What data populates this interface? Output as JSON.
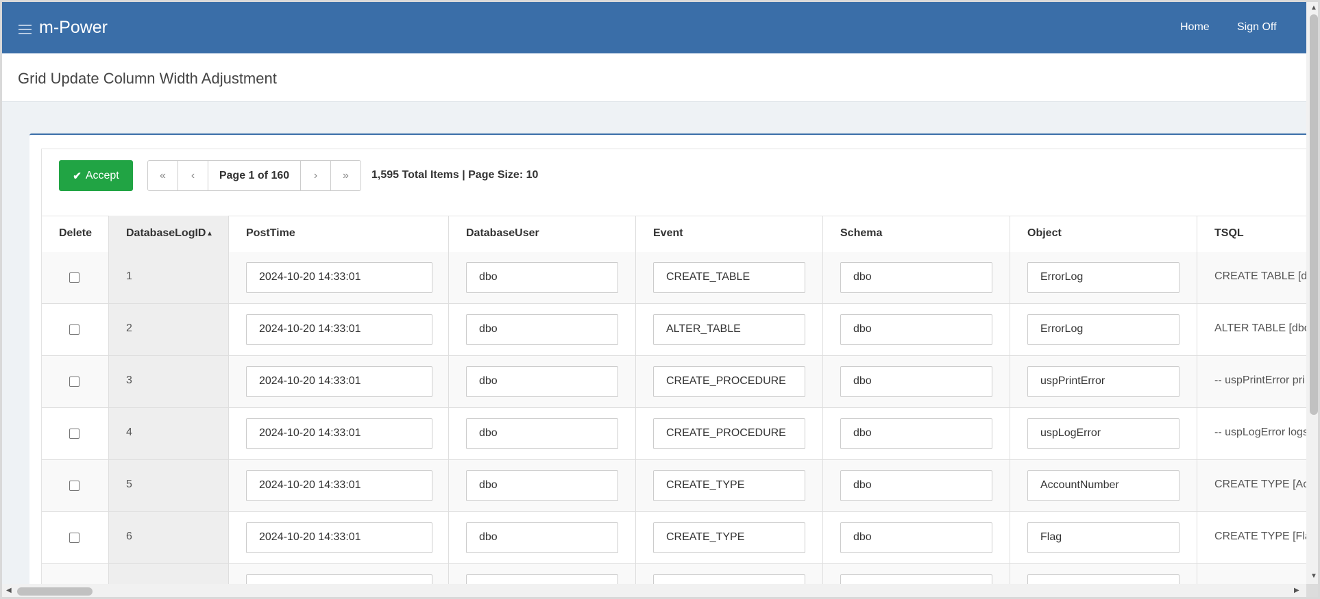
{
  "header": {
    "brand": "m-Power",
    "nav": [
      {
        "label": "Home"
      },
      {
        "label": "Sign Off"
      }
    ]
  },
  "page": {
    "title": "Grid Update Column Width Adjustment"
  },
  "toolbar": {
    "accept_label": "Accept",
    "accept_icon": "check-icon",
    "pager": {
      "first_icon": "«",
      "prev_icon": "‹",
      "page_info": "Page 1 of 160",
      "next_icon": "›",
      "last_icon": "»"
    },
    "totals": "1,595 Total Items | Page Size: 10"
  },
  "grid": {
    "columns": [
      "Delete",
      "DatabaseLogID",
      "PostTime",
      "DatabaseUser",
      "Event",
      "Schema",
      "Object",
      "TSQL"
    ],
    "sort_indicator": "▲",
    "rows": [
      {
        "id": "1",
        "posttime": "2024-10-20 14:33:01",
        "user": "dbo",
        "event": "CREATE_TABLE",
        "schema": "dbo",
        "object": "ErrorLog",
        "tsql": "CREATE TABLE [dl"
      },
      {
        "id": "2",
        "posttime": "2024-10-20 14:33:01",
        "user": "dbo",
        "event": "ALTER_TABLE",
        "schema": "dbo",
        "object": "ErrorLog",
        "tsql": "ALTER TABLE [dbo"
      },
      {
        "id": "3",
        "posttime": "2024-10-20 14:33:01",
        "user": "dbo",
        "event": "CREATE_PROCEDURE",
        "schema": "dbo",
        "object": "uspPrintError",
        "tsql": "-- uspPrintError pri"
      },
      {
        "id": "4",
        "posttime": "2024-10-20 14:33:01",
        "user": "dbo",
        "event": "CREATE_PROCEDURE",
        "schema": "dbo",
        "object": "uspLogError",
        "tsql": "-- uspLogError logs"
      },
      {
        "id": "5",
        "posttime": "2024-10-20 14:33:01",
        "user": "dbo",
        "event": "CREATE_TYPE",
        "schema": "dbo",
        "object": "AccountNumber",
        "tsql": "CREATE TYPE [Ac"
      },
      {
        "id": "6",
        "posttime": "2024-10-20 14:33:01",
        "user": "dbo",
        "event": "CREATE_TYPE",
        "schema": "dbo",
        "object": "Flag",
        "tsql": "CREATE TYPE [Fla"
      },
      {
        "id": "",
        "posttime": "",
        "user": "",
        "event": "",
        "schema": "",
        "object": "",
        "tsql": ""
      }
    ]
  },
  "colors": {
    "header_bg": "#3a6ea8",
    "accept_bg": "#21a444"
  }
}
